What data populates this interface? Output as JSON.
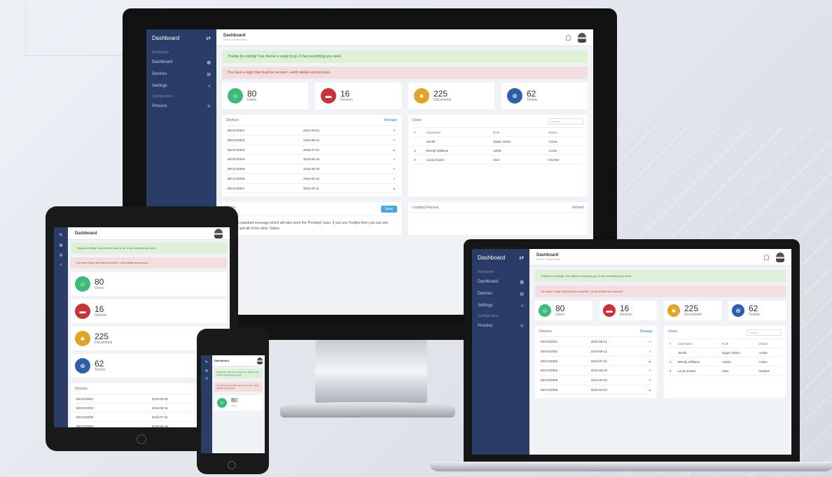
{
  "app": {
    "sidebar_title": "Dashboard",
    "section_main": "Navigation",
    "section_other": "Configuration",
    "nav": [
      "Dashboard",
      "Devices",
      "Settings"
    ],
    "nav_extra": "Process",
    "page_title": "Dashboard",
    "page_subtitle": "Home / Dashboard"
  },
  "alerts": {
    "success": "Thanks for visiting! Your theme is ready to go. It has everything you need.",
    "error": "You have a login that must be secured - verify details and process."
  },
  "stats": [
    {
      "value": "80",
      "label": "Users",
      "color": "#3dbb7a",
      "icon": "users-icon"
    },
    {
      "value": "16",
      "label": "Devices",
      "color": "#c7343b",
      "icon": "server-icon"
    },
    {
      "value": "225",
      "label": "Documents",
      "color": "#e0a428",
      "icon": "sitemap-icon"
    },
    {
      "value": "62",
      "label": "Tickets",
      "color": "#2f5fa8",
      "icon": "lifebuoy-icon"
    }
  ],
  "devices_panel": {
    "title": "Devices",
    "link": "Manage",
    "rows": [
      {
        "name": "DEVICE001",
        "date": "2016-09-01",
        "ok": true
      },
      {
        "name": "DEVICE002",
        "date": "2016-08-12",
        "ok": true
      },
      {
        "name": "DEVICE003",
        "date": "2016-07-21",
        "ok": false
      },
      {
        "name": "DEVICE004",
        "date": "2016-06-18",
        "ok": true
      },
      {
        "name": "DEVICE005",
        "date": "2016-05-30",
        "ok": true
      },
      {
        "name": "DEVICE006",
        "date": "2016-04-22",
        "ok": true
      },
      {
        "name": "DEVICE007",
        "date": "2016-03-11",
        "ok": false
      }
    ]
  },
  "users_panel": {
    "title": "Users",
    "search_placeholder": "Search",
    "headers": [
      "#",
      "Username",
      "Role",
      "Status"
    ],
    "rows": [
      {
        "id": "",
        "user": "Jsmith",
        "role": "Super Admin",
        "status": "Active"
      },
      {
        "id": "1",
        "user": "Wendy Williams",
        "role": "Admin",
        "status": "Active"
      },
      {
        "id": "2",
        "user": "Lucas Evans",
        "role": "User",
        "status": "Inactive"
      }
    ]
  },
  "notes_panel": {
    "title": "Notes",
    "button": "Save",
    "text": "This is a standard message which will also work the 'Pending' class. If you use Tooltips then you can see Multiple and all of the other Tables."
  },
  "loading_panel": {
    "title": "Loading Process",
    "link": "Reload"
  }
}
